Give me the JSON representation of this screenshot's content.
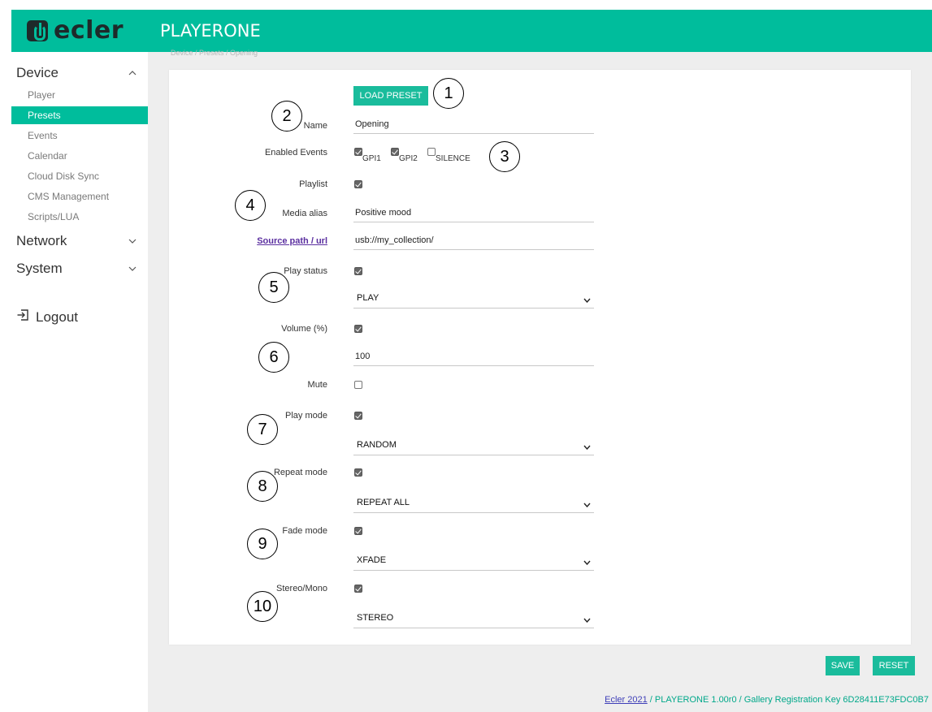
{
  "header": {
    "logo_text": "ecler",
    "app_title": "PLAYERONE",
    "breadcrumb": "Device / Presets / Opening"
  },
  "sidebar": {
    "sections": [
      {
        "label": "Device",
        "expanded": true
      },
      {
        "label": "Network",
        "expanded": false
      },
      {
        "label": "System",
        "expanded": false
      }
    ],
    "items": [
      {
        "label": "Player",
        "active": false
      },
      {
        "label": "Presets",
        "active": true
      },
      {
        "label": "Events",
        "active": false
      },
      {
        "label": "Calendar",
        "active": false
      },
      {
        "label": "Cloud Disk Sync",
        "active": false
      },
      {
        "label": "CMS Management",
        "active": false
      },
      {
        "label": "Scripts/LUA",
        "active": false
      }
    ],
    "logout_label": "Logout"
  },
  "form": {
    "load_preset_label": "LOAD PRESET",
    "name_label": "Name",
    "name_value": "Opening",
    "enabled_events_label": "Enabled Events",
    "events": [
      {
        "label": "GPI1",
        "checked": true
      },
      {
        "label": "GPI2",
        "checked": true
      },
      {
        "label": "SILENCE",
        "checked": false
      }
    ],
    "playlist_label": "Playlist",
    "playlist_checked": true,
    "media_alias_label": "Media alias",
    "media_alias_value": "Positive mood",
    "source_path_label": "Source path / url",
    "source_path_value": "usb://my_collection/",
    "play_status_label": "Play status",
    "play_status_checked": true,
    "play_status_value": "PLAY",
    "volume_label": "Volume (%)",
    "volume_checked": true,
    "volume_value": "100",
    "mute_label": "Mute",
    "mute_checked": false,
    "play_mode_label": "Play mode",
    "play_mode_checked": true,
    "play_mode_value": "RANDOM",
    "repeat_mode_label": "Repeat mode",
    "repeat_mode_checked": true,
    "repeat_mode_value": "REPEAT ALL",
    "fade_mode_label": "Fade mode",
    "fade_mode_checked": true,
    "fade_mode_value": "XFADE",
    "stereo_mono_label": "Stereo/Mono",
    "stereo_mono_checked": true,
    "stereo_mono_value": "STEREO"
  },
  "callouts": [
    "1",
    "2",
    "3",
    "4",
    "5",
    "6",
    "7",
    "8",
    "9",
    "10"
  ],
  "actions": {
    "save_label": "SAVE",
    "reset_label": "RESET"
  },
  "footer": {
    "link_text": "Ecler 2021",
    "text": " / PLAYERONE 1.00r0 / Gallery Registration Key 6D28411E73FDC0B7"
  },
  "colors": {
    "accent": "#00bd9c",
    "link": "#5b2fa0"
  }
}
